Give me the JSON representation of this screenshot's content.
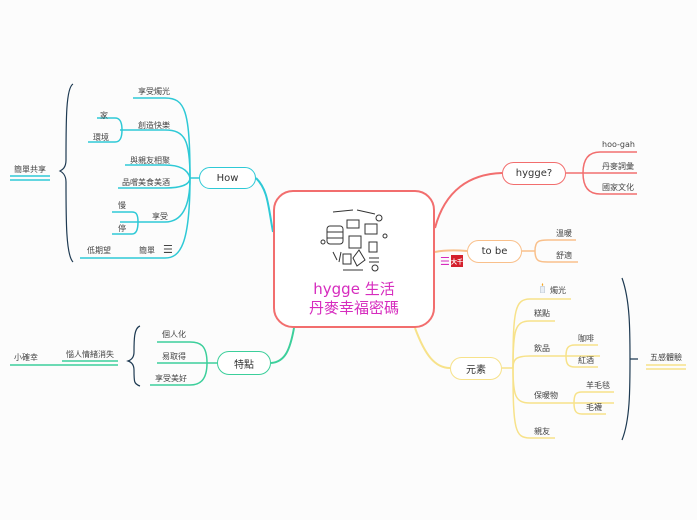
{
  "central": {
    "title_line1": "hygge 生活",
    "title_line2": "丹麥幸福密碼",
    "image": "hygge-doodle-illustration"
  },
  "colors": {
    "central_border": "#f26e6e",
    "central_text": "#d62cbe",
    "how_branch": "#2ec9d6",
    "hygge_branch": "#f26e6e",
    "tobe_branch": "#f9c08b",
    "tedian_branch": "#3ccf9b",
    "yuansu_branch": "#f7e28a",
    "summary_brace": "#1e3a52"
  },
  "branches": {
    "how": {
      "label": "How",
      "children": [
        "享受燭光",
        "創造快樂",
        "與親友相聚",
        "品嚐美食美酒",
        "享受",
        "簡單"
      ],
      "chuangzao_children": [
        "家",
        "環境"
      ],
      "xiangshou_children": [
        "慢",
        "停"
      ],
      "jiandan_children": [
        "低期望"
      ],
      "summary": "簡單共享",
      "jiandan_icon": "menu-icon"
    },
    "hygge": {
      "label": "hygge?",
      "children": [
        "hoo-gah",
        "丹麥詞彙",
        "國家文化"
      ]
    },
    "tobe": {
      "label": "to be",
      "children": [
        "溫暖",
        "舒適"
      ],
      "icons": [
        "menu-icon",
        "red-badge-icon"
      ]
    },
    "tedian": {
      "label": "特點",
      "children": [
        "個人化",
        "易取得",
        "享受美好"
      ],
      "summary": "惱人情緒消失",
      "summary_child": "小確幸"
    },
    "yuansu": {
      "label": "元素",
      "children": [
        "燭光",
        "糕點",
        "飲品",
        "保暖物",
        "親友"
      ],
      "yinpin_children": [
        "咖啡",
        "紅酒"
      ],
      "baonuan_children": [
        "羊毛毯",
        "毛襪"
      ],
      "summary": "五感體驗",
      "candle_icon": "candle-icon"
    }
  }
}
